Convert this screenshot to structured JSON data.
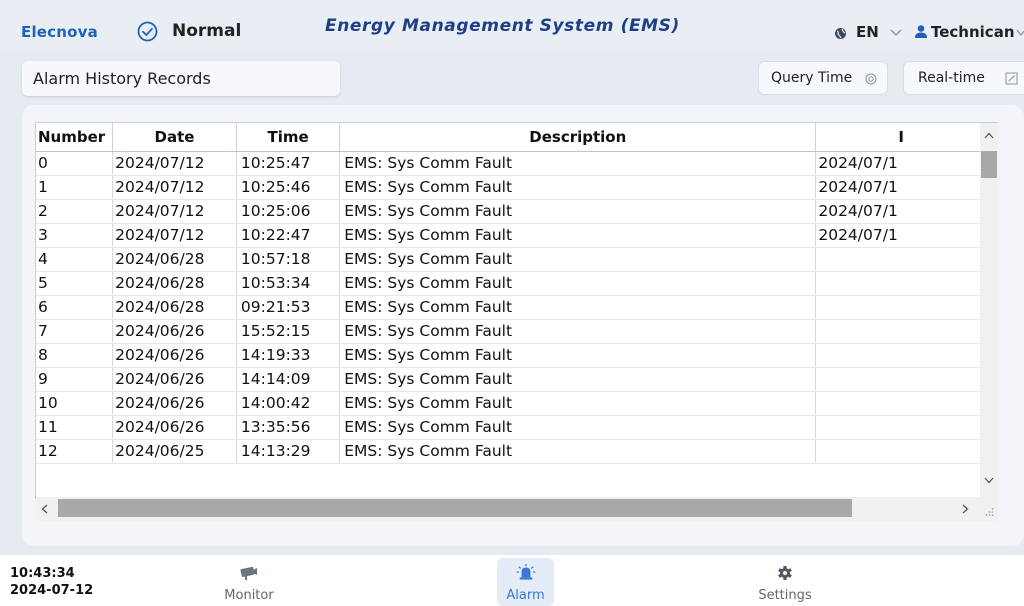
{
  "header": {
    "brand": "Elecnova",
    "status": "Normal",
    "title": "Energy Management System (EMS)",
    "language": "EN",
    "user": "Technican",
    "accent_color": "#1f63b8",
    "title_color": "#1e3f86"
  },
  "toolbar": {
    "page_title": "Alarm History Records",
    "query_time_label": "Query Time",
    "realtime_label": "Real-time"
  },
  "table": {
    "columns": [
      "Number",
      "Date",
      "Time",
      "Description",
      "I"
    ],
    "rows": [
      {
        "number": "0",
        "date": "2024/07/12",
        "time": "10:25:47",
        "description": "EMS: Sys Comm Fault",
        "extra": "2024/07/1"
      },
      {
        "number": "1",
        "date": "2024/07/12",
        "time": "10:25:46",
        "description": "EMS: Sys Comm Fault",
        "extra": "2024/07/1"
      },
      {
        "number": "2",
        "date": "2024/07/12",
        "time": "10:25:06",
        "description": "EMS: Sys Comm Fault",
        "extra": "2024/07/1"
      },
      {
        "number": "3",
        "date": "2024/07/12",
        "time": "10:22:47",
        "description": "EMS: Sys Comm Fault",
        "extra": "2024/07/1"
      },
      {
        "number": "4",
        "date": "2024/06/28",
        "time": "10:57:18",
        "description": "EMS: Sys Comm Fault",
        "extra": ""
      },
      {
        "number": "5",
        "date": "2024/06/28",
        "time": "10:53:34",
        "description": "EMS: Sys Comm Fault",
        "extra": ""
      },
      {
        "number": "6",
        "date": "2024/06/28",
        "time": "09:21:53",
        "description": "EMS: Sys Comm Fault",
        "extra": ""
      },
      {
        "number": "7",
        "date": "2024/06/26",
        "time": "15:52:15",
        "description": "EMS: Sys Comm Fault",
        "extra": ""
      },
      {
        "number": "8",
        "date": "2024/06/26",
        "time": "14:19:33",
        "description": "EMS: Sys Comm Fault",
        "extra": ""
      },
      {
        "number": "9",
        "date": "2024/06/26",
        "time": "14:14:09",
        "description": "EMS: Sys Comm Fault",
        "extra": ""
      },
      {
        "number": "10",
        "date": "2024/06/26",
        "time": "14:00:42",
        "description": "EMS: Sys Comm Fault",
        "extra": ""
      },
      {
        "number": "11",
        "date": "2024/06/26",
        "time": "13:35:56",
        "description": "EMS: Sys Comm Fault",
        "extra": ""
      },
      {
        "number": "12",
        "date": "2024/06/25",
        "time": "14:13:29",
        "description": "EMS: Sys Comm Fault",
        "extra": ""
      }
    ]
  },
  "footer": {
    "time": "10:43:34",
    "date": "2024-07-12",
    "nav": [
      {
        "label": "Monitor",
        "icon": "camera-icon",
        "active": false
      },
      {
        "label": "Alarm",
        "icon": "alarm-siren-icon",
        "active": true
      },
      {
        "label": "Settings",
        "icon": "gear-icon",
        "active": false
      }
    ],
    "active_color": "#3a78d4"
  }
}
